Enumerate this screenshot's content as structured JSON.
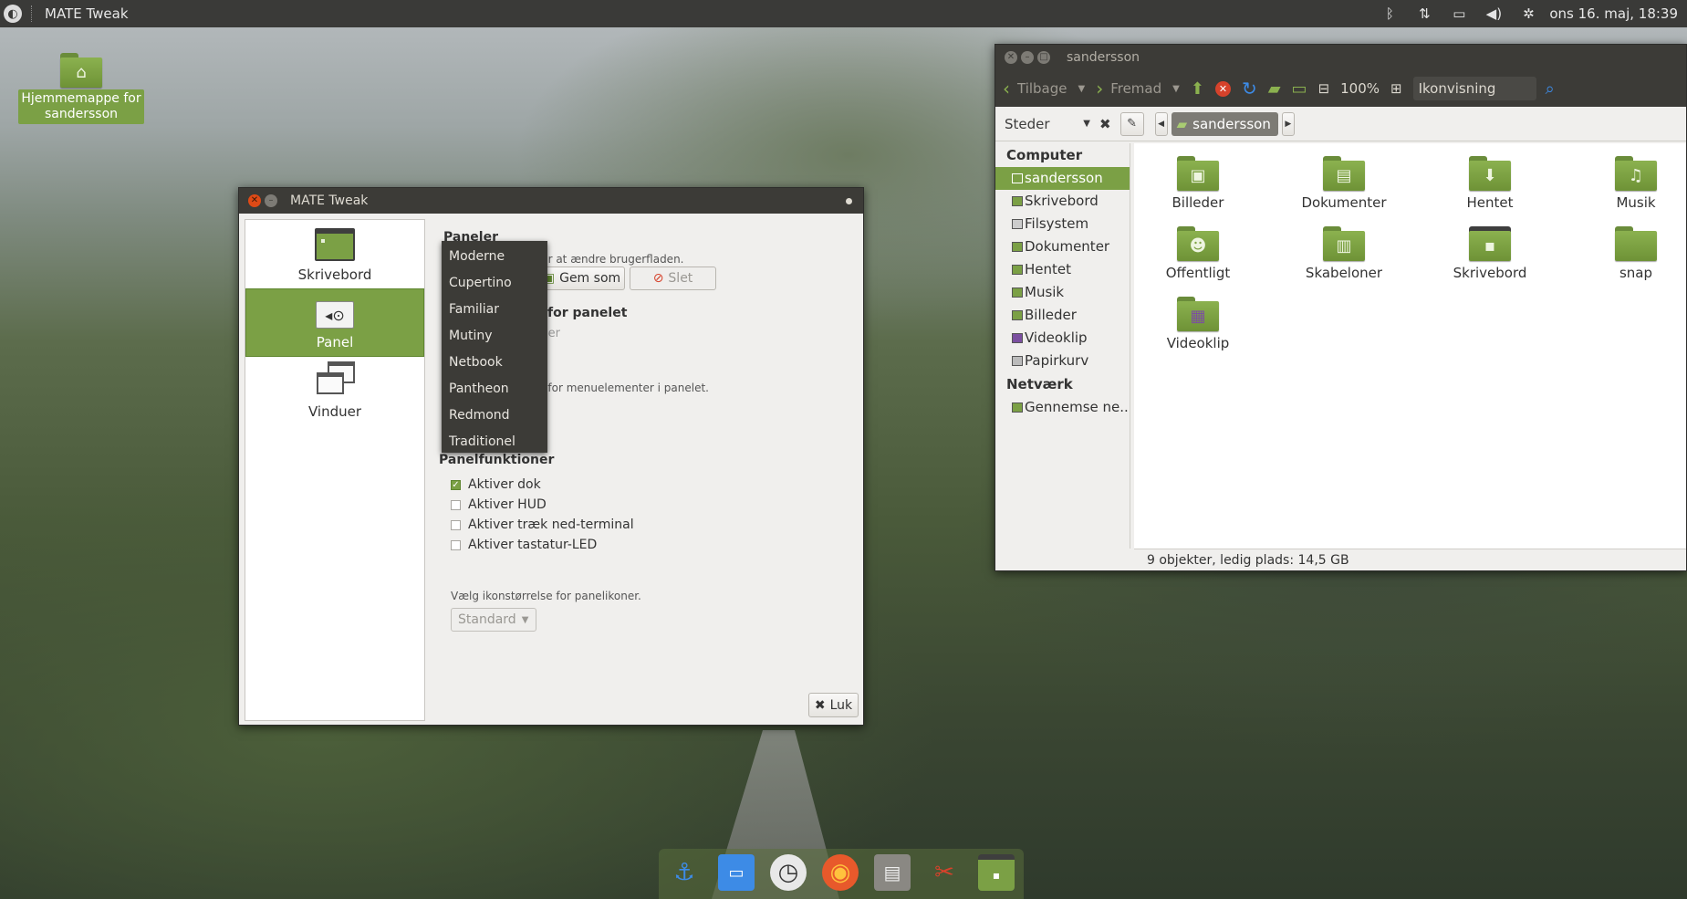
{
  "top_panel": {
    "app_title": "MATE Tweak",
    "clock": "ons 16. maj, 18:39",
    "indicators": [
      "bluetooth-icon",
      "network-icon",
      "battery-icon",
      "volume-icon",
      "settings-icon"
    ]
  },
  "desktop": {
    "home_icon_label": "Hjemmemappe for sandersson"
  },
  "tweak_window": {
    "title": "MATE Tweak",
    "categories": [
      {
        "label": "Skrivebord",
        "icon": "desktop-icon"
      },
      {
        "label": "Panel",
        "icon": "panel-icon",
        "active": true
      },
      {
        "label": "Vinduer",
        "icon": "windows-icon"
      }
    ],
    "panels_heading": "Paneler",
    "panels_hint": "for at ændre brugerfladen.",
    "save_as_label": "Gem som",
    "delete_label": "Slet",
    "panel_features_heading": "for panelet",
    "partial_dim_text": "mer",
    "menu_hint": "n for menuelementer i panelet.",
    "partial_letter": "M",
    "layout_menu": [
      "Moderne",
      "Cupertino",
      "Familiar",
      "Mutiny",
      "Netbook",
      "Pantheon",
      "Redmond",
      "Traditionel"
    ],
    "functions_heading": "Panelfunktioner",
    "checkboxes": [
      {
        "label": "Aktiver dok",
        "checked": true
      },
      {
        "label": "Aktiver HUD",
        "checked": false
      },
      {
        "label": "Aktiver træk ned-terminal",
        "checked": false
      },
      {
        "label": "Aktiver tastatur-LED",
        "checked": false
      }
    ],
    "icon_size_label": "Vælg ikonstørrelse for panelikoner.",
    "icon_size_value": "Standard",
    "close_label": "Luk"
  },
  "file_manager": {
    "title": "sandersson",
    "back_label": "Tilbage",
    "forward_label": "Fremad",
    "zoom": "100%",
    "view_mode": "Ikonvisning",
    "places_label": "Steder",
    "crumb": "sandersson",
    "sidebar": {
      "computer_heading": "Computer",
      "computer_items": [
        "sandersson",
        "Skrivebord",
        "Filsystem",
        "Dokumenter",
        "Hentet",
        "Musik",
        "Billeder",
        "Videoklip",
        "Papirkurv"
      ],
      "network_heading": "Netværk",
      "network_items": [
        "Gennemse ne..."
      ]
    },
    "items": [
      {
        "label": "Billeder",
        "glyph": "pictures-icon"
      },
      {
        "label": "Dokumenter",
        "glyph": "documents-icon"
      },
      {
        "label": "Hentet",
        "glyph": "download-icon"
      },
      {
        "label": "Musik",
        "glyph": "music-icon"
      },
      {
        "label": "Offentligt",
        "glyph": "public-icon"
      },
      {
        "label": "Skabeloner",
        "glyph": "templates-icon"
      },
      {
        "label": "Skrivebord",
        "glyph": "desktop-icon"
      },
      {
        "label": "snap",
        "glyph": "folder-icon"
      },
      {
        "label": "Videoklip",
        "glyph": "video-icon"
      }
    ],
    "status": "9 objekter, ledig plads: 14,5 GB"
  },
  "dock": [
    "anchor-icon",
    "files-icon",
    "clock-icon",
    "firefox-icon",
    "file-manager-icon",
    "tweak-tools-icon",
    "desktop-icon"
  ],
  "colors": {
    "accent": "#7ba045",
    "panel_bg": "#3a3a38",
    "titlebar_bg": "#3c3b37",
    "close_button": "#df4a16"
  }
}
